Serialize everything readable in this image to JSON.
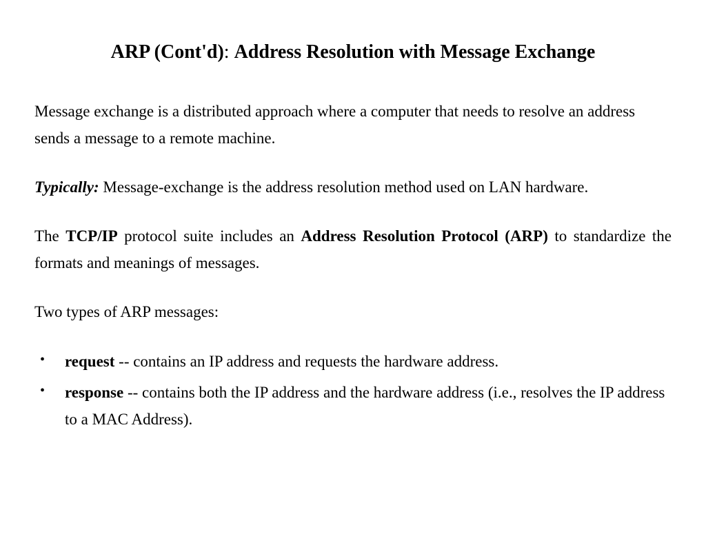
{
  "title": {
    "left": "ARP (Cont'd)",
    "sep": ": ",
    "right": "Address Resolution with Message Exchange"
  },
  "p1": "Message exchange is a distributed approach where a computer that needs to resolve an address sends a message to a remote machine.",
  "p2_label": "Typically:",
  "p2_text": "  Message-exchange is the address resolution method used on LAN hardware.",
  "p3_a": "The ",
  "p3_b": "TCP/IP",
  "p3_c": " protocol suite includes an ",
  "p3_d": "Address Resolution Protocol (ARP)",
  "p3_e": " to standardize the formats and meanings of messages.",
  "p4": "Two types of ARP messages:",
  "bullets": [
    {
      "term": "request",
      "desc": " -- contains an IP address and requests the hardware address."
    },
    {
      "term": "response",
      "desc": " -- contains both the IP address and the hardware address (i.e., resolves the IP address to a MAC Address)."
    }
  ]
}
